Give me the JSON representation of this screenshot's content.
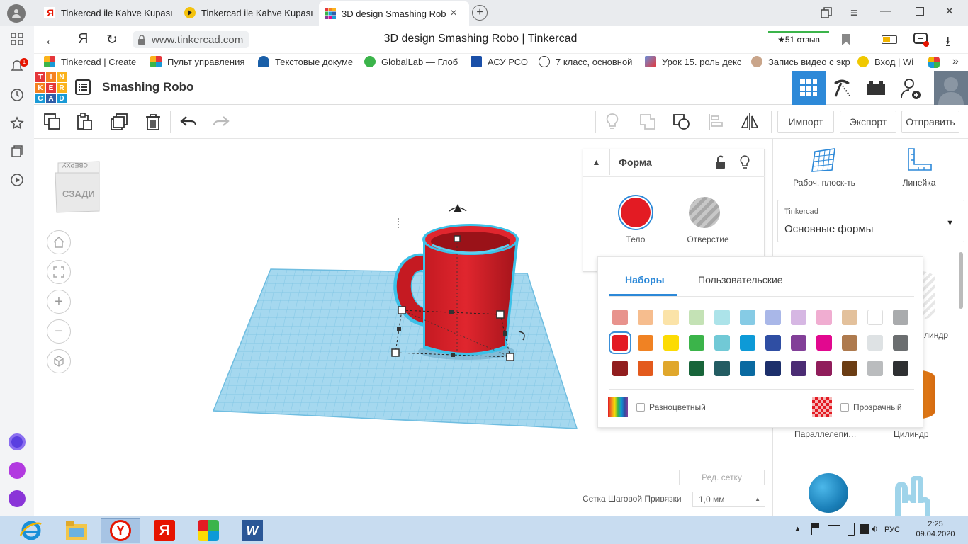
{
  "browser": {
    "tabs": [
      {
        "title": "Tinkercad ile Kahve Kupası",
        "active": false
      },
      {
        "title": "Tinkercad ile Kahve Kupası",
        "active": false
      },
      {
        "title": "3D design Smashing Rob",
        "active": true
      }
    ],
    "address": "www.tinkercad.com",
    "page_title": "3D design Smashing Robo | Tinkercad",
    "reviews": "★51 отзыв",
    "yandex_letter": "Я"
  },
  "bookmarks": [
    "Tinkercad | Create",
    "Пульт управления",
    "Текстовые докуме",
    "GlobalLab — Глоб",
    "АСУ РСО",
    "7 класс, основной",
    "Урок 15. роль декс",
    "Запись видео с экр",
    "Вход | Wi"
  ],
  "left_rail": {
    "notification_count": "1"
  },
  "tinkercad": {
    "logo": [
      "T",
      "I",
      "N",
      "K",
      "E",
      "R",
      "C",
      "A",
      "D"
    ],
    "logo_colors": [
      "#e5373b",
      "#f58220",
      "#fbb31c",
      "#f58220",
      "#e5373b",
      "#fbb31c",
      "#1a9ad6",
      "#2f5ea9",
      "#1a9ad6"
    ],
    "design_name": "Smashing Robo",
    "buttons": {
      "import": "Импорт",
      "export": "Экспорт",
      "send": "Отправить"
    },
    "viewcube": {
      "front": "СЗАДИ",
      "top": "СВЕРХУ"
    }
  },
  "shape_panel": {
    "title": "Форма",
    "solid_label": "Тело",
    "hole_label": "Отверстие",
    "solid_color": "#e31b23"
  },
  "color_panel": {
    "tabs": [
      "Наборы",
      "Пользовательские"
    ],
    "rows": [
      [
        "#e8938d",
        "#f6bd8e",
        "#fbe3a8",
        "#c4e2b5",
        "#ace3e9",
        "#86cbe5",
        "#a9b7e8",
        "#d6b7e3",
        "#f0add1",
        "#e3c19c",
        "#ffffff",
        "#a9abad"
      ],
      [
        "#e31b23",
        "#f08223",
        "#fcdb04",
        "#3bb44a",
        "#71c9d6",
        "#0d9ad7",
        "#2f4ea3",
        "#823f98",
        "#e2088f",
        "#ae7a4e",
        "#dee2e4",
        "#6b6e70"
      ],
      [
        "#911d1e",
        "#e35a1d",
        "#e0a72c",
        "#18653a",
        "#235c62",
        "#0a6aa1",
        "#1c2f6b",
        "#4b2c74",
        "#901d5b",
        "#6b3d14",
        "#babcbe",
        "#2e3032"
      ]
    ],
    "multicolor_label": "Разноцветный",
    "transparent_label": "Прозрачный"
  },
  "right_panel": {
    "workplane_label": "Рабоч. плоск-ть",
    "ruler_label": "Линейка",
    "library_source": "Tinkercad",
    "library_selected": "Основные формы",
    "shapes": [
      {
        "label": "Параллелепи…"
      },
      {
        "label": "Цилиндр"
      },
      {
        "label": "линдр"
      }
    ]
  },
  "bottom": {
    "edit_grid": "Ред. сетку",
    "snap_label": "Сетка Шаговой Привязки",
    "snap_value": "1,0 мм"
  },
  "taskbar": {
    "language": "РУС",
    "time": "2:25",
    "date": "09.04.2020"
  }
}
